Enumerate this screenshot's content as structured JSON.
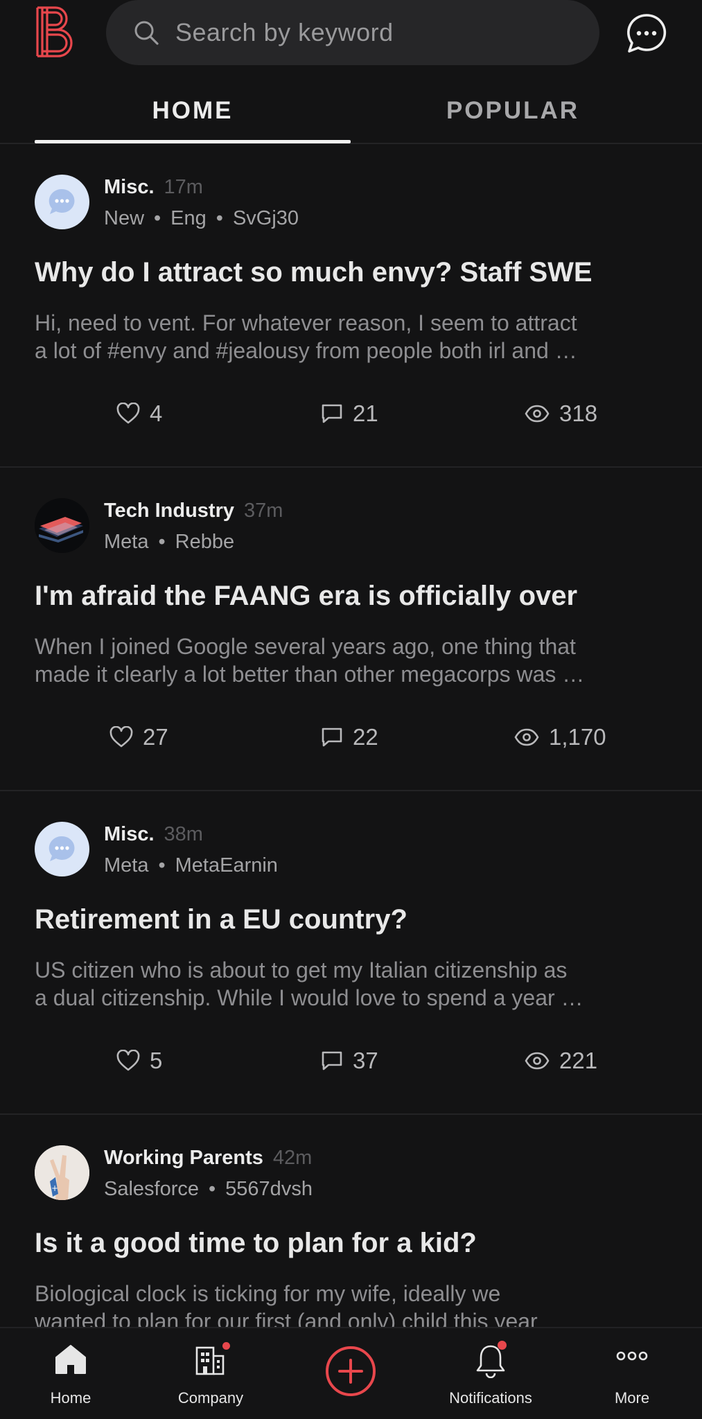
{
  "header": {
    "search_placeholder": "Search by keyword",
    "logo_icon": "blind-logo",
    "chat_icon": "chat-bubble-icon"
  },
  "tabs": [
    {
      "label": "HOME",
      "active": true
    },
    {
      "label": "POPULAR",
      "active": false
    }
  ],
  "posts": [
    {
      "channel": "Misc.",
      "time": "17m",
      "meta": [
        "New",
        "Eng",
        "SvGj30"
      ],
      "title": "Why do I attract so much envy? Staff SWE",
      "snippet": [
        "Hi, need to vent. For whatever reason, I seem to attract",
        "a lot of #envy and #jealousy from people both irl and …"
      ],
      "likes": "4",
      "comments": "21",
      "views": "318",
      "avatar": "misc-chat-icon"
    },
    {
      "channel": "Tech Industry",
      "time": "37m",
      "meta": [
        "Meta",
        "Rebbe"
      ],
      "title": "I'm afraid the FAANG era is officially over",
      "snippet": [
        "When I joined Google several years ago, one thing that",
        "made it clearly a lot better than other megacorps was …"
      ],
      "likes": "27",
      "comments": "22",
      "views": "1,170",
      "avatar": "tech-industry-image"
    },
    {
      "channel": "Misc.",
      "time": "38m",
      "meta": [
        "Meta",
        "MetaEarnin"
      ],
      "title": "Retirement in a EU country?",
      "snippet": [
        "US citizen who is about to get my Italian citizenship as",
        "a dual citizenship.  While I would love to spend a year …"
      ],
      "likes": "5",
      "comments": "37",
      "views": "221",
      "avatar": "misc-chat-icon"
    },
    {
      "channel": "Working Parents",
      "time": "42m",
      "meta": [
        "Salesforce",
        "5567dvsh"
      ],
      "title": "Is it a good time to plan for a kid?",
      "snippet": [
        "Biological clock is ticking for my wife, ideally we",
        "wanted to plan for our first (and only) child this year"
      ],
      "avatar": "working-parents-image"
    }
  ],
  "bottom_nav": [
    {
      "label": "Home",
      "icon": "home-icon"
    },
    {
      "label": "Company",
      "icon": "company-icon"
    },
    {
      "label": "",
      "icon": "add-circle-icon"
    },
    {
      "label": "Notifications",
      "icon": "bell-icon"
    },
    {
      "label": "More",
      "icon": "more-icon"
    }
  ],
  "colors": {
    "background": "#131314",
    "accent": "#e8474c",
    "search_bg": "#262628"
  }
}
